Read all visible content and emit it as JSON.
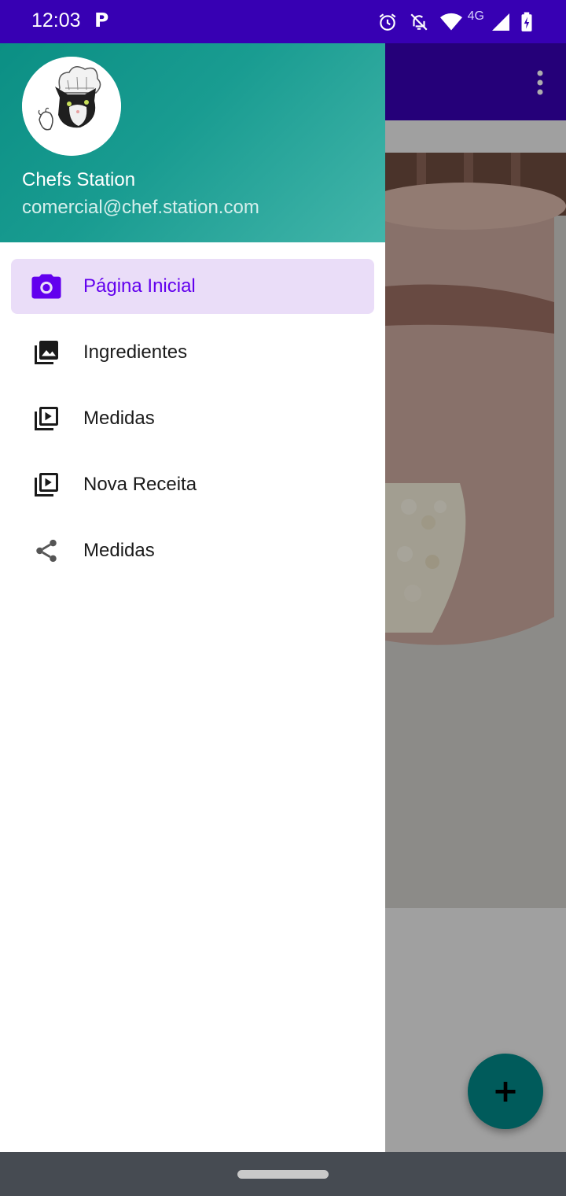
{
  "status_bar": {
    "time": "12:03",
    "app_indicator": "P",
    "network_type": "4G",
    "icons": [
      "alarm-icon",
      "notifications-off-icon",
      "wifi-icon",
      "cell-signal-icon",
      "battery-charging-icon"
    ]
  },
  "drawer": {
    "header": {
      "name": "Chefs Station",
      "email": "comercial@chef.station.com"
    },
    "items": [
      {
        "label": "Página Inicial",
        "icon": "camera-icon",
        "active": true
      },
      {
        "label": "Ingredientes",
        "icon": "photo-library-icon",
        "active": false
      },
      {
        "label": "Medidas",
        "icon": "video-library-icon",
        "active": false
      },
      {
        "label": "Nova Receita",
        "icon": "video-library-icon",
        "active": false
      },
      {
        "label": "Medidas",
        "icon": "share-icon",
        "active": false
      }
    ]
  },
  "fab": {
    "label": "+",
    "icon": "add-icon"
  },
  "colors": {
    "status_bar": "#3700B3",
    "drawer_header": "#199c91",
    "active_item_bg": "#EADDF8",
    "active_item_text": "#6200EE",
    "fab": "#018786"
  }
}
